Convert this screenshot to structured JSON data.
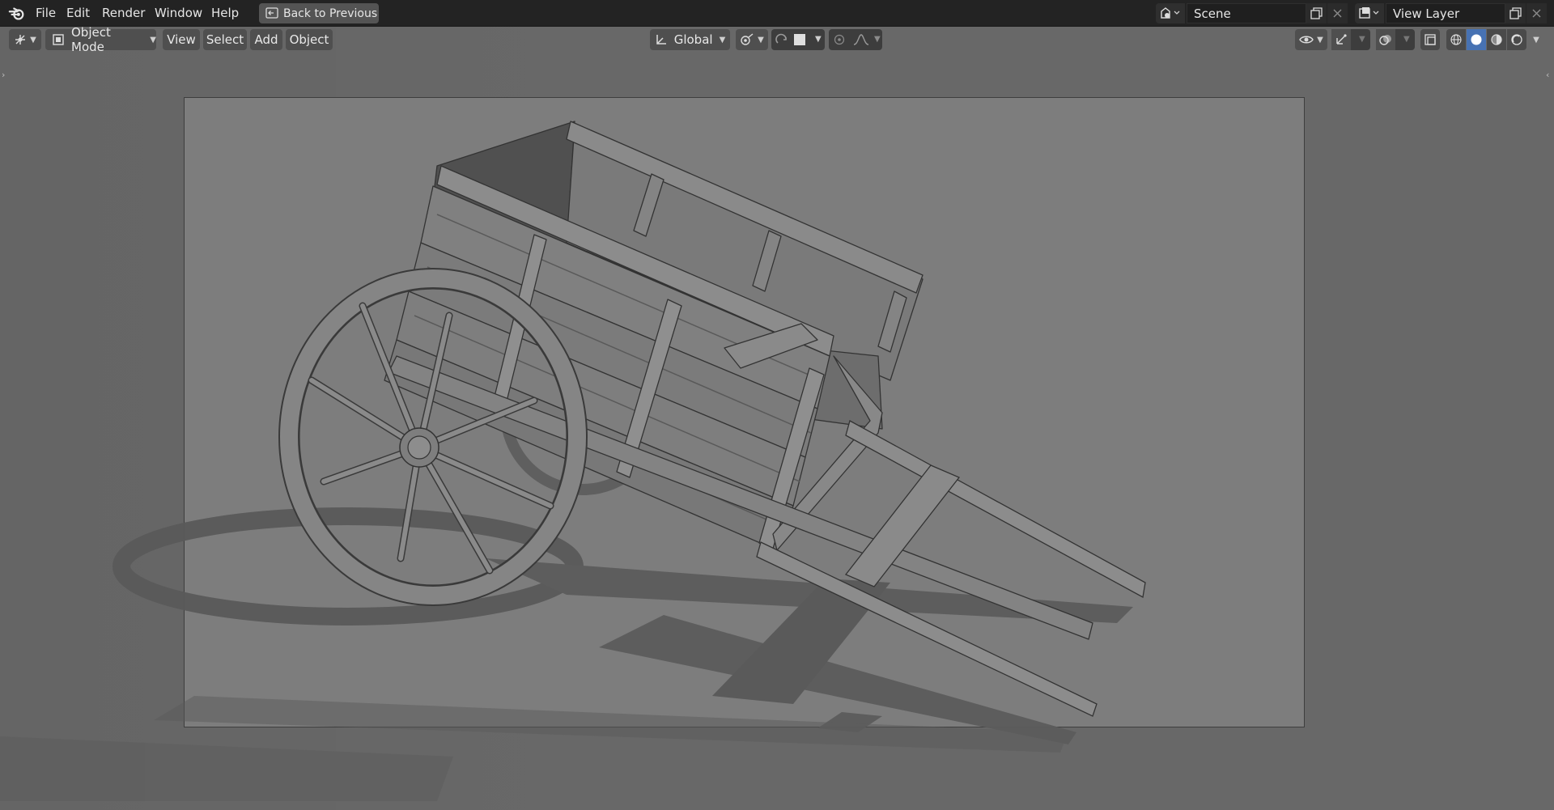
{
  "window": {
    "menus": [
      "File",
      "Edit",
      "Render",
      "Window",
      "Help"
    ],
    "back_button": "Back to Previous",
    "scene_name": "Scene",
    "view_layer_name": "View Layer"
  },
  "viewport_header": {
    "mode": "Object Mode",
    "menus": [
      "View",
      "Select",
      "Add",
      "Object"
    ],
    "transform_orientation": "Global"
  },
  "icons": {
    "logo": "blender-logo-icon",
    "back": "back-to-previous-icon",
    "scene": "scene-icon",
    "view_layer": "view-layer-icon",
    "editor_type": "3d-viewport-editor-icon",
    "mode": "object-mode-icon",
    "orientation": "transform-orientation-icon",
    "pivot": "pivot-point-icon",
    "snap": "snap-icon",
    "proportional": "proportional-editing-icon",
    "visibility": "object-visibility-icon",
    "gizmo": "gizmo-icon",
    "overlay": "overlay-icon",
    "xray": "xray-icon",
    "shading": [
      "wireframe-shading-icon",
      "solid-shading-icon",
      "material-preview-icon",
      "rendered-shading-icon"
    ]
  },
  "colors": {
    "topbar": "#232323",
    "viewport_bg": "#686868",
    "camera_frame": "#7d7d7d",
    "active_shading": "#4772b3",
    "button": "#4f4f4f"
  }
}
